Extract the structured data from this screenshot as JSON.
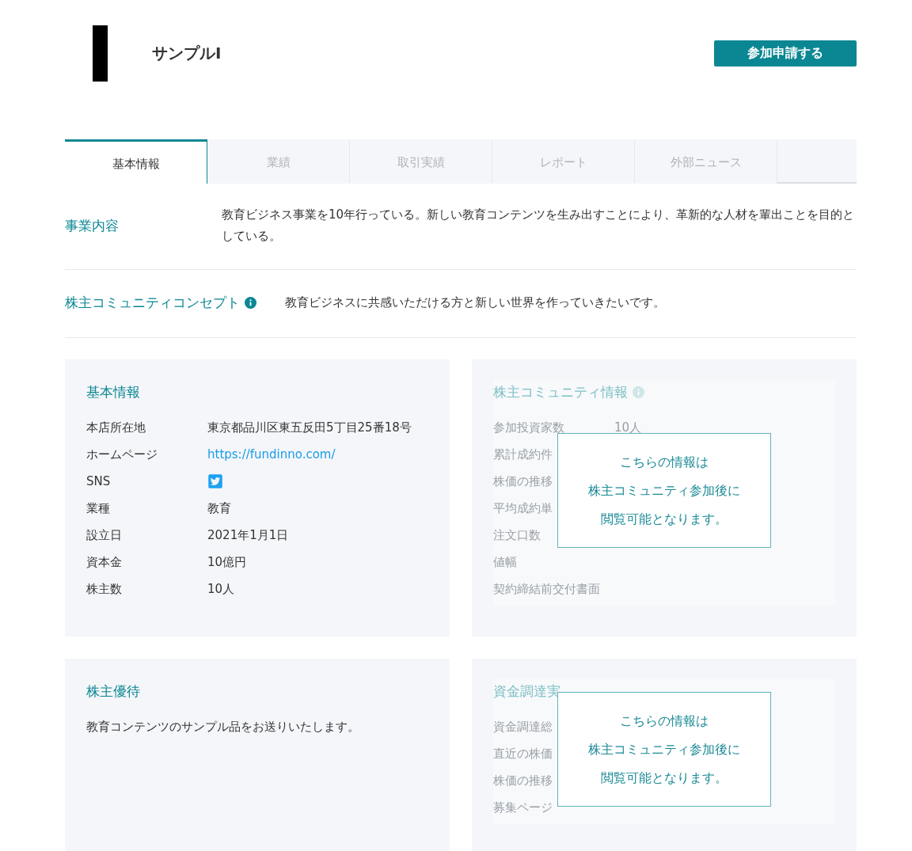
{
  "header": {
    "title": "サンプルI",
    "apply_button": "参加申請する"
  },
  "tabs": [
    {
      "label": "基本情報",
      "selected": true
    },
    {
      "label": "業績",
      "selected": false
    },
    {
      "label": "取引実績",
      "selected": false
    },
    {
      "label": "レポート",
      "selected": false
    },
    {
      "label": "外部ニュース",
      "selected": false
    }
  ],
  "overview": [
    {
      "label": "事業内容",
      "info": false,
      "text": "教育ビジネス事業を10年行っている。新しい教育コンテンツを生み出すことにより、革新的な人材を輩出ことを目的としている。"
    },
    {
      "label": "株主コミュニティコンセプト",
      "info": true,
      "text": "教育ビジネスに共感いただける方と新しい世界を作っていきたいです。"
    }
  ],
  "cards": [
    {
      "kind": "info",
      "title": "基本情報",
      "rows": [
        {
          "label": "本店所在地",
          "kind": "text",
          "value": "東京都品川区東五反田5丁目25番18号"
        },
        {
          "label": "ホームページ",
          "kind": "link",
          "value": "https://fundinno.com/"
        },
        {
          "label": "SNS",
          "kind": "sns"
        },
        {
          "label": "業種",
          "kind": "text",
          "value": "教育"
        },
        {
          "label": "設立日",
          "kind": "text",
          "value": "2021年1月1日"
        },
        {
          "label": "資本金",
          "kind": "text",
          "value": "10億円"
        },
        {
          "label": "株主数",
          "kind": "text",
          "value": "10人"
        }
      ]
    },
    {
      "kind": "locked",
      "title": "株主コミュニティ情報",
      "info": true,
      "notice": [
        "こちらの情報は",
        "株主コミュニティ参加後に",
        "閲覧可能となります。"
      ],
      "rows": [
        {
          "label": "参加投資家数",
          "value": "10人"
        },
        {
          "label": "累計成約件"
        },
        {
          "label": "株価の推移"
        },
        {
          "label": "平均成約単"
        },
        {
          "label": "注文口数"
        },
        {
          "label": "値幅"
        },
        {
          "label": "契約締結前交付書面"
        }
      ]
    },
    {
      "kind": "text",
      "title": "株主優待",
      "text": "教育コンテンツのサンプル品をお送りいたします。"
    },
    {
      "kind": "locked",
      "title": "資金調達実",
      "info": false,
      "notice": [
        "こちらの情報は",
        "株主コミュニティ参加後に",
        "閲覧可能となります。"
      ],
      "rows": [
        {
          "label": "資金調達総"
        },
        {
          "label": "直近の株価"
        },
        {
          "label": "株価の推移"
        },
        {
          "label": "募集ページ"
        }
      ]
    }
  ]
}
